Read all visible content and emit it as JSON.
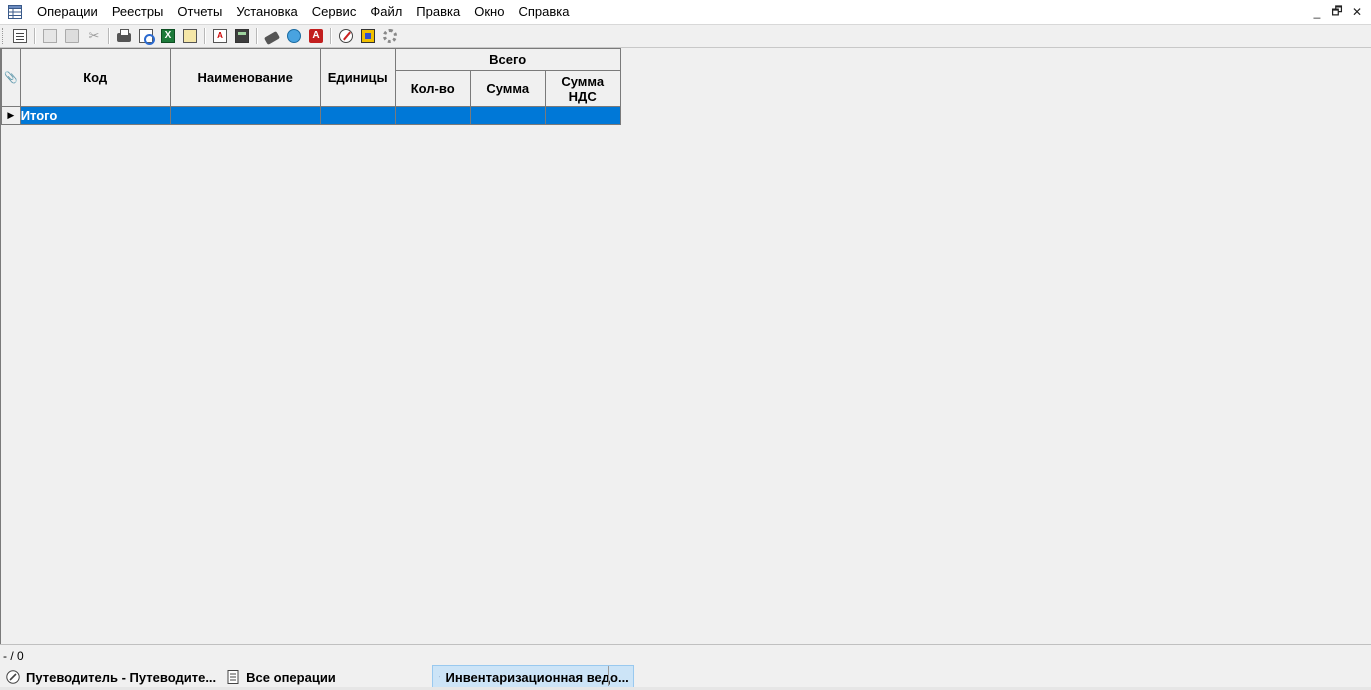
{
  "menu": {
    "items": [
      "Операции",
      "Реестры",
      "Отчеты",
      "Установка",
      "Сервис",
      "Файл",
      "Правка",
      "Окно",
      "Справка"
    ],
    "window_controls": [
      "_",
      "🗗",
      "✕"
    ]
  },
  "toolbar": {
    "icons": [
      "form-view-icon",
      "copy-icon",
      "paste-icon",
      "cut-icon",
      "print-icon",
      "print-preview-icon",
      "excel-export-icon",
      "report-icon",
      "report-a-icon",
      "calculator-icon",
      "eraser-icon",
      "globe-icon",
      "red-a-icon",
      "compass-icon",
      "palette-icon",
      "settings-icon"
    ]
  },
  "grid": {
    "headers": {
      "code": "Код",
      "name": "Наименование",
      "units": "Единицы",
      "total_group": "Всего",
      "qty": "Кол-во",
      "sum": "Сумма",
      "vat_sum_line1": "Сумма",
      "vat_sum_line2": "НДС"
    },
    "total_row": {
      "code": "Итого",
      "name": "",
      "units": "",
      "qty": "",
      "sum": "",
      "vat_sum": ""
    },
    "selection_color": "#0078d7"
  },
  "status": {
    "position": "- / 0"
  },
  "tasks": [
    {
      "label": "Путеводитель - Путеводите...",
      "icon": "compass-icon"
    },
    {
      "label": "Все операции",
      "icon": "document-icon"
    },
    {
      "label": "Инвентаризационная ведо...",
      "icon": "table-icon"
    }
  ]
}
